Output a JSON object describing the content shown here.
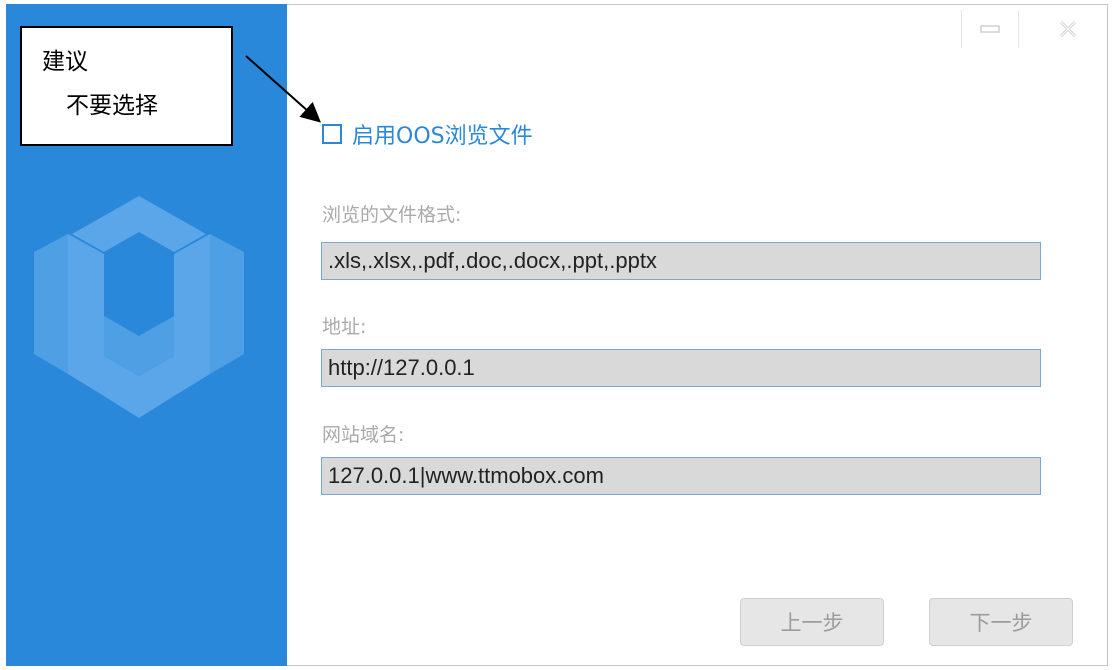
{
  "annotation": {
    "line1": "建议",
    "line2": "不要选择"
  },
  "titlebar": {
    "minimize_icon": "minimize-icon",
    "close_icon": "close-icon"
  },
  "form": {
    "checkbox_label": "启用OOS浏览文件",
    "checkbox_checked": false,
    "formats_label": "浏览的文件格式:",
    "formats_value": ".xls,.xlsx,.pdf,.doc,.docx,.ppt,.pptx",
    "address_label": "地址:",
    "address_value": "http://127.0.0.1",
    "domain_label": "网站域名:",
    "domain_value": "127.0.0.1|www.ttmobox.com"
  },
  "buttons": {
    "prev_label": "上一步",
    "next_label": "下一步"
  },
  "colors": {
    "accent": "#2a88da",
    "input_bg": "#d9d9d9"
  }
}
